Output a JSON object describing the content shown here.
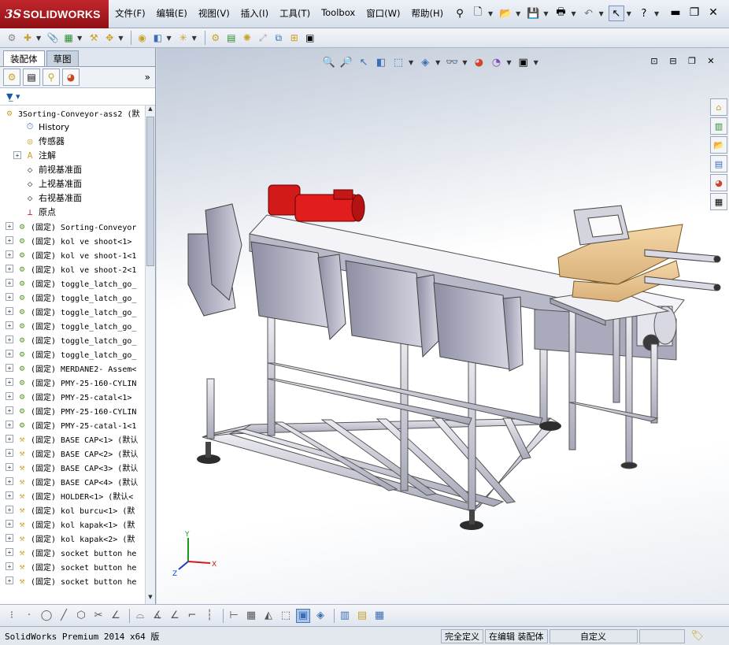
{
  "app": {
    "brand_ds": "3S",
    "brand_name": "SOLIDWORKS"
  },
  "menu": [
    "文件(F)",
    "编辑(E)",
    "视图(V)",
    "插入(I)",
    "工具(T)",
    "Toolbox",
    "窗口(W)",
    "帮助(H)"
  ],
  "panel": {
    "tabs": [
      "装配体",
      "草图"
    ],
    "more": "»",
    "filter_icon": "funnel-icon"
  },
  "tree": {
    "root": "3Sorting-Conveyor-ass2  (默",
    "features": [
      {
        "label": "History",
        "icon": "history-icon"
      },
      {
        "label": "传感器",
        "icon": "sensor-icon"
      },
      {
        "label": "注解",
        "icon": "annotation-icon"
      },
      {
        "label": "前视基准面",
        "icon": "plane-icon"
      },
      {
        "label": "上视基准面",
        "icon": "plane-icon"
      },
      {
        "label": "右视基准面",
        "icon": "plane-icon"
      },
      {
        "label": "原点",
        "icon": "origin-icon"
      }
    ],
    "components": [
      "(固定) Sorting-Conveyor",
      "(固定) kol ve shoot<1>",
      "(固定) kol ve shoot-1<1",
      "(固定) kol ve shoot-2<1",
      "(固定) toggle_latch_go_",
      "(固定) toggle_latch_go_",
      "(固定) toggle_latch_go_",
      "(固定) toggle_latch_go_",
      "(固定) toggle_latch_go_",
      "(固定) toggle_latch_go_",
      "(固定) MERDANE2- Assem<",
      "(固定) PMY-25-160-CYLIN",
      "(固定) PMY-25-catal<1>",
      "(固定) PMY-25-160-CYLIN",
      "(固定) PMY-25-catal-1<1",
      "(固定) BASE CAP<1> (默认",
      "(固定) BASE CAP<2> (默认",
      "(固定) BASE CAP<3> (默认",
      "(固定) BASE CAP<4> (默认",
      "(固定) HOLDER<1> (默认<",
      "(固定) kol burcu<1> (默",
      "(固定) kol kapak<1> (默",
      "(固定) kol kapak<2> (默",
      "(固定) socket button he",
      "(固定) socket button he",
      "(固定) socket button he"
    ]
  },
  "triad": {
    "x": "X",
    "y": "Y",
    "z": "Z"
  },
  "status": {
    "text": "SolidWorks Premium 2014 x64 版",
    "defined": "完全定义",
    "editing": "在编辑 装配体",
    "custom": "自定义"
  }
}
